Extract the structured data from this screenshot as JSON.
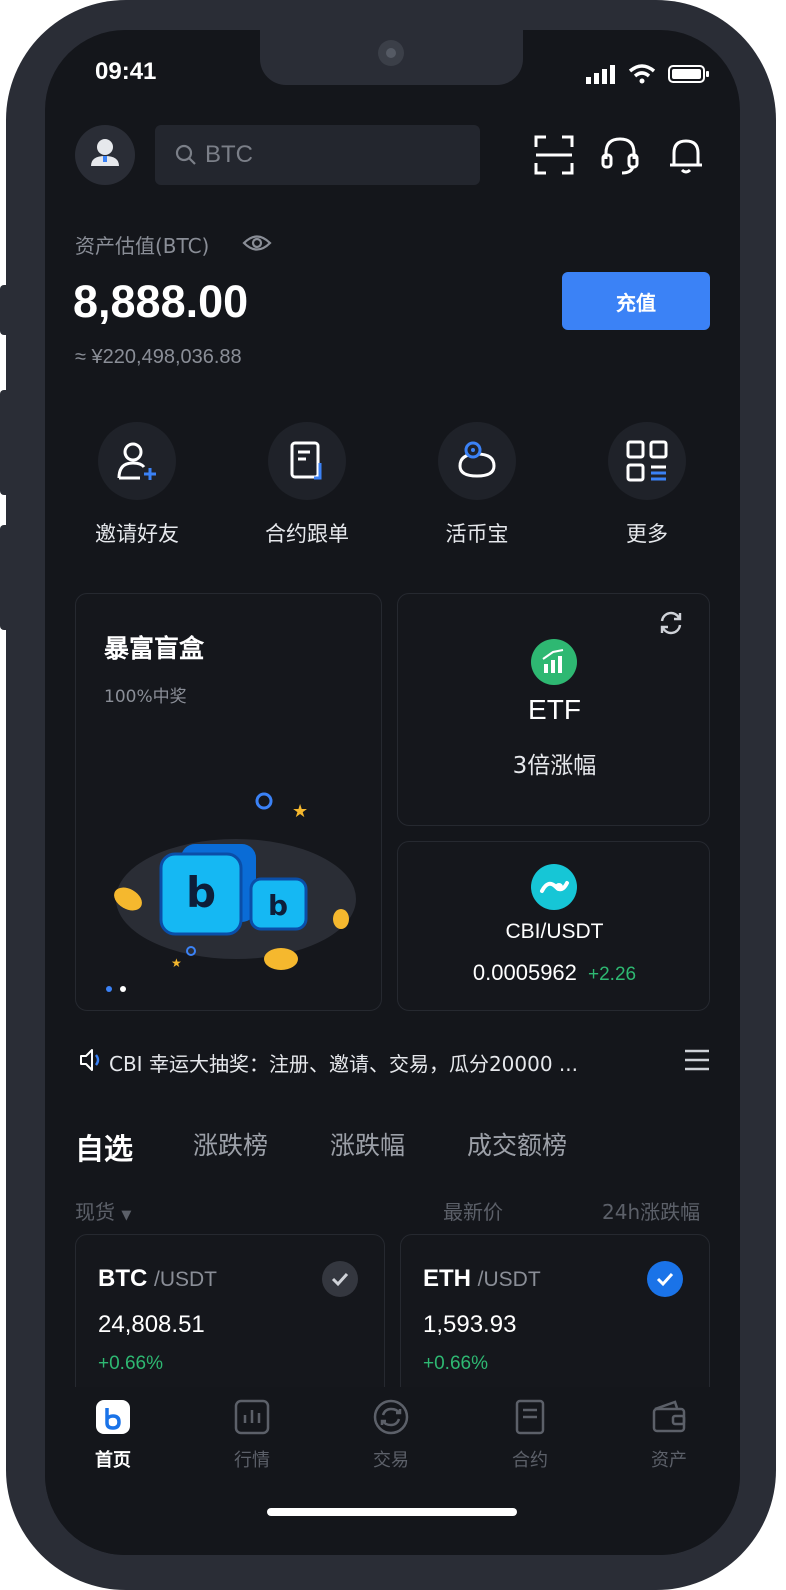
{
  "status": {
    "time": "09:41"
  },
  "search": {
    "placeholder": "BTC"
  },
  "assets": {
    "label": "资产估值(BTC)",
    "value": "8,888.00",
    "cny": "≈ ¥220,498,036.88",
    "recharge_label": "充值"
  },
  "quick_actions": [
    {
      "label": "邀请好友",
      "icon": "invite-friend-icon"
    },
    {
      "label": "合约跟单",
      "icon": "copy-trade-icon"
    },
    {
      "label": "活币宝",
      "icon": "piggy-bank-icon"
    },
    {
      "label": "更多",
      "icon": "more-grid-icon"
    }
  ],
  "promo": {
    "title": "暴富盲盒",
    "subtitle": "100%中奖"
  },
  "etf": {
    "title": "ETF",
    "subtitle": "3倍涨幅"
  },
  "ticker_card": {
    "pair": "CBI/USDT",
    "price": "0.0005962",
    "change": "+2.26"
  },
  "announcement": {
    "text": "CBI 幸运大抽奖：注册、邀请、交易，瓜分20000 ..."
  },
  "market_tabs": [
    "自选",
    "涨跌榜",
    "涨跌幅",
    "成交额榜"
  ],
  "columns": {
    "spot": "现货",
    "latest_price": "最新价",
    "change_24h": "24h涨跌幅"
  },
  "watchlist": [
    {
      "base": "BTC",
      "quote": "/USDT",
      "price": "24,808.51",
      "change": "+0.66%",
      "checked": false
    },
    {
      "base": "ETH",
      "quote": "/USDT",
      "price": "1,593.93",
      "change": "+0.66%",
      "checked": true
    }
  ],
  "nav": [
    {
      "label": "首页",
      "icon": "home-icon",
      "active": true
    },
    {
      "label": "行情",
      "icon": "market-icon",
      "active": false
    },
    {
      "label": "交易",
      "icon": "trade-icon",
      "active": false
    },
    {
      "label": "合约",
      "icon": "contract-icon",
      "active": false
    },
    {
      "label": "资产",
      "icon": "wallet-icon",
      "active": false
    }
  ],
  "colors": {
    "accent": "#3b82f6",
    "up": "#2eb872",
    "bg": "#14161b"
  }
}
